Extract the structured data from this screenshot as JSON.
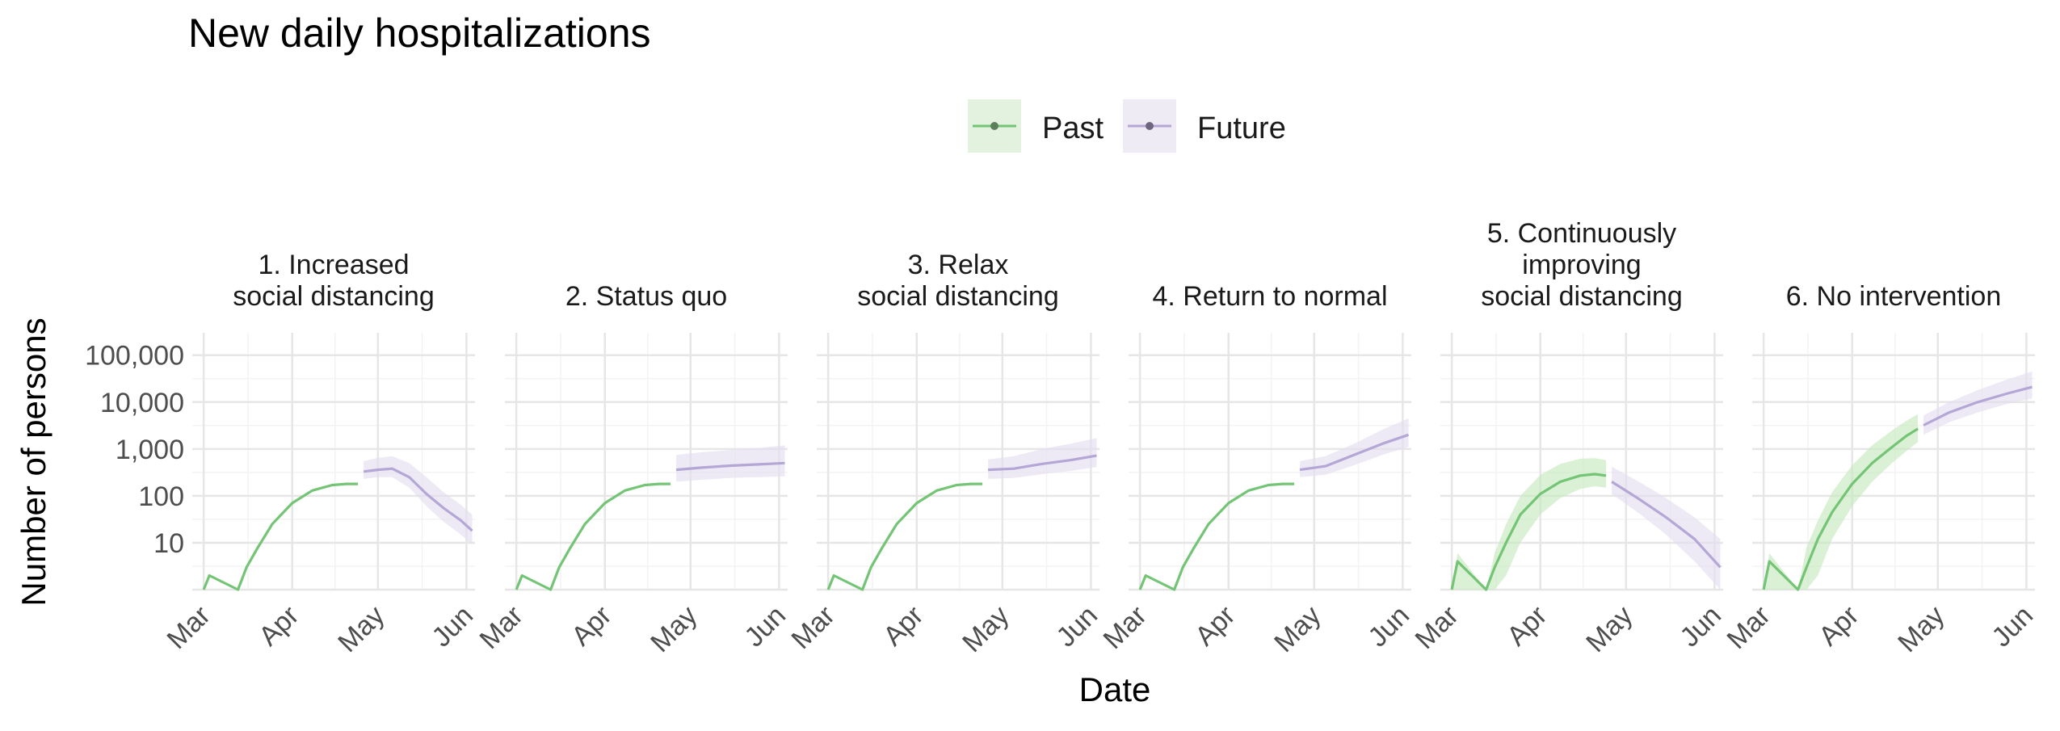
{
  "chart_data": {
    "type": "line",
    "title": "New daily hospitalizations",
    "xlabel": "Date",
    "ylabel": "Number of persons",
    "y_scale": "log10",
    "ylim": [
      1,
      300000
    ],
    "y_ticks": [
      10,
      100,
      1000,
      10000,
      100000
    ],
    "y_tick_labels": [
      "10",
      "100",
      "1,000",
      "10,000",
      "100,000"
    ],
    "x_ticks": [
      "2020-03-01",
      "2020-04-01",
      "2020-05-01",
      "2020-06-01"
    ],
    "x_tick_labels": [
      "Mar",
      "Apr",
      "May",
      "Jun"
    ],
    "xlim": [
      "2020-02-26",
      "2020-06-04"
    ],
    "grid": true,
    "legend": {
      "position": "top",
      "entries": [
        {
          "name": "Past",
          "color": "#74c476"
        },
        {
          "name": "Future",
          "color": "#b4a7d6"
        }
      ]
    },
    "colors": {
      "past_line": "#74c476",
      "past_band": "#c7e9c0",
      "future_line": "#b4a7d6",
      "future_band": "#e5dff0"
    },
    "panels": [
      {
        "title": "1. Increased\nsocial distancing",
        "past": {
          "x": [
            "2020-03-01",
            "2020-03-03",
            "2020-03-13",
            "2020-03-16",
            "2020-03-20",
            "2020-03-25",
            "2020-04-01",
            "2020-04-08",
            "2020-04-15",
            "2020-04-20",
            "2020-04-24"
          ],
          "y": [
            1,
            2,
            1,
            3,
            8,
            25,
            70,
            130,
            170,
            180,
            180
          ],
          "lower": [
            1,
            2,
            1,
            3,
            8,
            25,
            70,
            130,
            170,
            180,
            180
          ],
          "upper": [
            1,
            2,
            1,
            3,
            8,
            25,
            70,
            130,
            170,
            180,
            180
          ]
        },
        "future": {
          "x": [
            "2020-04-26",
            "2020-05-01",
            "2020-05-06",
            "2020-05-12",
            "2020-05-18",
            "2020-05-24",
            "2020-05-30",
            "2020-06-03"
          ],
          "y": [
            330,
            360,
            380,
            250,
            110,
            55,
            30,
            18
          ],
          "lower": [
            230,
            250,
            250,
            150,
            60,
            28,
            15,
            9
          ],
          "upper": [
            550,
            650,
            700,
            500,
            250,
            120,
            65,
            40
          ]
        }
      },
      {
        "title": "2. Status quo",
        "past": {
          "x": [
            "2020-03-01",
            "2020-03-03",
            "2020-03-13",
            "2020-03-16",
            "2020-03-20",
            "2020-03-25",
            "2020-04-01",
            "2020-04-08",
            "2020-04-15",
            "2020-04-20",
            "2020-04-24"
          ],
          "y": [
            1,
            2,
            1,
            3,
            8,
            25,
            70,
            130,
            170,
            180,
            180
          ],
          "lower": [
            1,
            2,
            1,
            3,
            8,
            25,
            70,
            130,
            170,
            180,
            180
          ],
          "upper": [
            1,
            2,
            1,
            3,
            8,
            25,
            70,
            130,
            170,
            180,
            180
          ]
        },
        "future": {
          "x": [
            "2020-04-26",
            "2020-05-05",
            "2020-05-15",
            "2020-05-25",
            "2020-06-03"
          ],
          "y": [
            360,
            400,
            440,
            470,
            500
          ],
          "lower": [
            200,
            220,
            240,
            250,
            260
          ],
          "upper": [
            750,
            850,
            950,
            1050,
            1200
          ]
        }
      },
      {
        "title": "3. Relax\nsocial distancing",
        "past": {
          "x": [
            "2020-03-01",
            "2020-03-03",
            "2020-03-13",
            "2020-03-16",
            "2020-03-20",
            "2020-03-25",
            "2020-04-01",
            "2020-04-08",
            "2020-04-15",
            "2020-04-20",
            "2020-04-24"
          ],
          "y": [
            1,
            2,
            1,
            3,
            8,
            25,
            70,
            130,
            170,
            180,
            180
          ],
          "lower": [
            1,
            2,
            1,
            3,
            8,
            25,
            70,
            130,
            170,
            180,
            180
          ],
          "upper": [
            1,
            2,
            1,
            3,
            8,
            25,
            70,
            130,
            170,
            180,
            180
          ]
        },
        "future": {
          "x": [
            "2020-04-26",
            "2020-05-05",
            "2020-05-15",
            "2020-05-25",
            "2020-06-03"
          ],
          "y": [
            360,
            380,
            480,
            580,
            720
          ],
          "lower": [
            230,
            240,
            290,
            340,
            410
          ],
          "upper": [
            600,
            700,
            1000,
            1300,
            1700
          ]
        }
      },
      {
        "title": "4. Return to normal",
        "past": {
          "x": [
            "2020-03-01",
            "2020-03-03",
            "2020-03-13",
            "2020-03-16",
            "2020-03-20",
            "2020-03-25",
            "2020-04-01",
            "2020-04-08",
            "2020-04-15",
            "2020-04-20",
            "2020-04-24"
          ],
          "y": [
            1,
            2,
            1,
            3,
            8,
            25,
            70,
            130,
            170,
            180,
            180
          ],
          "lower": [
            1,
            2,
            1,
            3,
            8,
            25,
            70,
            130,
            170,
            180,
            180
          ],
          "upper": [
            1,
            2,
            1,
            3,
            8,
            25,
            70,
            130,
            170,
            180,
            180
          ]
        },
        "future": {
          "x": [
            "2020-04-26",
            "2020-05-05",
            "2020-05-15",
            "2020-05-25",
            "2020-06-03"
          ],
          "y": [
            360,
            430,
            750,
            1300,
            2000
          ],
          "lower": [
            250,
            280,
            450,
            750,
            1100
          ],
          "upper": [
            550,
            700,
            1300,
            2600,
            4500
          ]
        }
      },
      {
        "title": "5. Continuously\nimproving\nsocial distancing",
        "past": {
          "x": [
            "2020-03-01",
            "2020-03-03",
            "2020-03-13",
            "2020-03-16",
            "2020-03-20",
            "2020-03-25",
            "2020-04-01",
            "2020-04-08",
            "2020-04-15",
            "2020-04-20",
            "2020-04-24"
          ],
          "y": [
            1,
            4,
            1,
            3,
            10,
            40,
            110,
            200,
            270,
            290,
            270
          ],
          "lower": [
            1,
            1,
            1,
            1,
            2,
            10,
            40,
            90,
            140,
            160,
            150
          ],
          "upper": [
            1,
            6,
            1,
            6,
            25,
            100,
            280,
            480,
            620,
            640,
            580
          ]
        },
        "future": {
          "x": [
            "2020-04-26",
            "2020-05-05",
            "2020-05-15",
            "2020-05-25",
            "2020-06-03"
          ],
          "y": [
            200,
            90,
            35,
            12,
            3
          ],
          "lower": [
            110,
            45,
            15,
            4,
            1
          ],
          "upper": [
            420,
            210,
            90,
            35,
            12
          ]
        }
      },
      {
        "title": "6. No intervention",
        "past": {
          "x": [
            "2020-03-01",
            "2020-03-03",
            "2020-03-13",
            "2020-03-16",
            "2020-03-20",
            "2020-03-25",
            "2020-04-01",
            "2020-04-08",
            "2020-04-15",
            "2020-04-20",
            "2020-04-24"
          ],
          "y": [
            1,
            4,
            1,
            3,
            12,
            45,
            180,
            500,
            1100,
            1900,
            2700
          ],
          "lower": [
            1,
            1,
            1,
            1,
            2,
            12,
            60,
            200,
            500,
            900,
            1400
          ],
          "upper": [
            1,
            6,
            1,
            8,
            30,
            120,
            450,
            1200,
            2500,
            4000,
            5500
          ]
        },
        "future": {
          "x": [
            "2020-04-26",
            "2020-05-05",
            "2020-05-15",
            "2020-05-25",
            "2020-06-03"
          ],
          "y": [
            3200,
            6000,
            10000,
            15000,
            21000
          ],
          "lower": [
            2000,
            3700,
            6000,
            9000,
            12000
          ],
          "upper": [
            5200,
            10000,
            18000,
            30000,
            45000
          ]
        }
      }
    ]
  }
}
